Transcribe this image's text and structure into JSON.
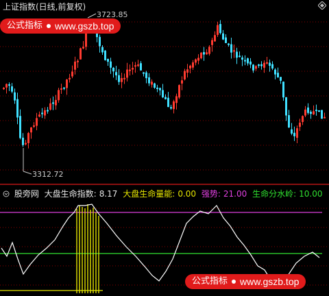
{
  "top_title": "上证指数(日线,前复权)",
  "price_high_label": "3723.85",
  "price_low_label": "3312.72",
  "watermark": {
    "brand": "公式指标",
    "site": "www.gszb.top"
  },
  "indicator_legend": {
    "name": "股旁网",
    "items": [
      {
        "label": "大盘生命指数:",
        "value": "8.17",
        "color": "#e6e6e6"
      },
      {
        "label": "大盘生命量能:",
        "value": "0.00",
        "color": "#e6e600"
      },
      {
        "label": "强势:",
        "value": "21.00",
        "color": "#e040e0"
      },
      {
        "label": "生命分水岭:",
        "value": "10.00",
        "color": "#30e030"
      }
    ]
  },
  "colors": {
    "up": "#ff3b30",
    "down": "#40e0ff",
    "grid": "#8b0000",
    "strong_line": "#e040e0",
    "divide_line": "#30e030",
    "volume": "#e6e600",
    "index_line": "#ffffff"
  }
}
